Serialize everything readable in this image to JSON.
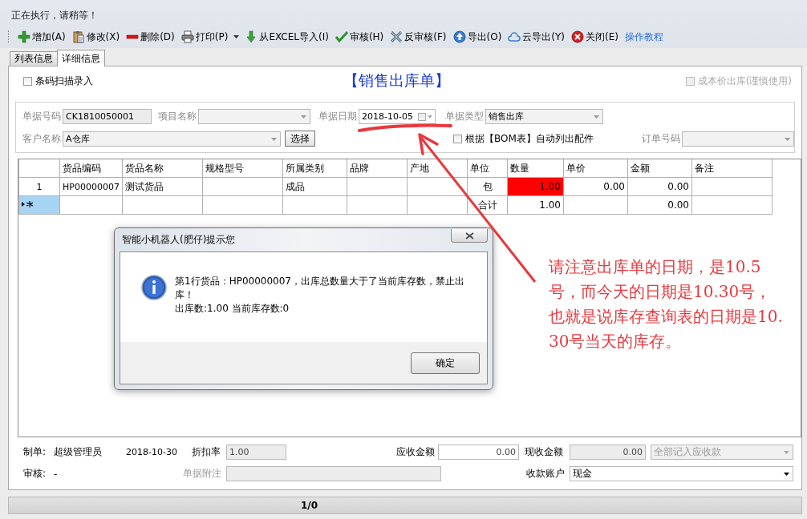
{
  "status_text": "正在执行，请稍等！",
  "toolbar": [
    {
      "label": "增加(A)",
      "kind": "button"
    },
    {
      "label": "修改(X)",
      "kind": "button"
    },
    {
      "label": "删除(D)",
      "kind": "button"
    },
    {
      "label": "打印(P)",
      "kind": "dropdown"
    },
    {
      "label": "从EXCEL导入(I)",
      "kind": "button"
    },
    {
      "label": "审核(H)",
      "kind": "button"
    },
    {
      "label": "反审核(F)",
      "kind": "button"
    },
    {
      "label": "导出(O)",
      "kind": "button"
    },
    {
      "label": "云导出(Y)",
      "kind": "button"
    },
    {
      "label": "关闭(E)",
      "kind": "button"
    },
    {
      "label": "操作教程",
      "kind": "link"
    }
  ],
  "tabs": [
    {
      "label": "列表信息",
      "selected": false
    },
    {
      "label": "详细信息",
      "selected": true
    }
  ],
  "form": {
    "title": "【销售出库单】",
    "barcode_entry": {
      "label": "条码扫描录入",
      "checked": false,
      "disabled": false
    },
    "cost_price": {
      "label": "成本价出库(谨慎使用)",
      "checked": false,
      "disabled": true
    },
    "field_rows": [
      [
        {
          "kind": "text",
          "label": "单据号码",
          "value": "CK1810050001"
        },
        {
          "kind": "select",
          "label": "项目名称"
        },
        {
          "kind": "date",
          "label": "单据日期",
          "value": "2018-10-05"
        },
        {
          "kind": "select",
          "label": "单据类型",
          "value": "销售出库"
        }
      ],
      [
        {
          "kind": "select",
          "label": "客户名称",
          "value": "A仓库"
        },
        {
          "kind": "button",
          "label": "选择"
        },
        {
          "kind": "checkbox",
          "label": "根据【BOM表】自动列出配件",
          "checked": false
        },
        {
          "kind": "select",
          "label": "订单号码"
        }
      ]
    ]
  },
  "grid": {
    "columns": [
      "货品编码",
      "货品名称",
      "规格型号",
      "所属类别",
      "品牌",
      "产地",
      "单位",
      "数量",
      "单价",
      "金额",
      "备注"
    ],
    "rows": [
      {
        "kind": "data",
        "header": "1",
        "selected": false,
        "cells": [
          {
            "text": "HP00000007",
            "error": false
          },
          {
            "text": "测试货品",
            "error": false
          },
          {
            "error": false
          },
          {
            "text": "成品",
            "error": false
          },
          {
            "error": false
          },
          {
            "error": false
          },
          {
            "text": "包",
            "error": false
          },
          {
            "text": "1.00",
            "error": true
          },
          {
            "text": "0.00",
            "error": false
          },
          {
            "text": "0.00",
            "error": false
          },
          {
            "error": false
          }
        ]
      },
      {
        "kind": "new",
        "selected": true,
        "cells": [
          {
            "error": false
          },
          {
            "error": false
          },
          {
            "error": false
          },
          {
            "error": false
          },
          {
            "error": false
          },
          {
            "error": false
          },
          {
            "text": "合计",
            "error": false
          },
          {
            "text": "1.00",
            "error": false
          },
          {
            "error": false
          },
          {
            "text": "0.00",
            "error": false
          },
          {
            "error": false
          }
        ]
      }
    ]
  },
  "footer": [
    [
      {
        "kind": "label",
        "text": "制单:"
      },
      {
        "kind": "value",
        "text": "超级管理员"
      },
      {
        "kind": "value",
        "text": "2018-10-30"
      },
      {
        "kind": "label",
        "text": "折扣率"
      },
      {
        "kind": "readonly",
        "value": "1.00"
      },
      {
        "kind": "label",
        "text": "应收金额"
      },
      {
        "kind": "input",
        "value": "0.00"
      },
      {
        "kind": "label",
        "text": "现收金额"
      },
      {
        "kind": "readonly",
        "value": "0.00"
      },
      {
        "kind": "select-disabled",
        "value": "全部记入应收款"
      }
    ],
    [
      {
        "kind": "label",
        "text": "审核:"
      },
      {
        "kind": "value",
        "text": "-"
      },
      {
        "kind": "muted",
        "text": "单据附注"
      },
      {
        "kind": "readonly"
      },
      {
        "kind": "label",
        "text": "收款账户"
      },
      {
        "kind": "select",
        "value": "现金"
      }
    ]
  ],
  "status_bar": "1/0",
  "dialog": {
    "title": "智能小机器人(肥仔)提示您",
    "message": "第1行货品：HP00000007，出库总数量大于了当前库存数，禁止出库！",
    "detail": "出库数:1.00 当前库存数:0",
    "button": "确定"
  },
  "annotation": {
    "text": "请注意出库单的日期，是10.5号，而今天的日期是10.30号，也就是说库存查询表的日期是10.30号当天的库存。"
  }
}
